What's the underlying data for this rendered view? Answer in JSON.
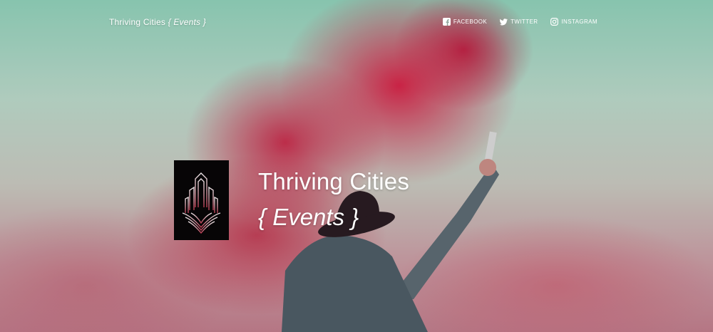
{
  "header": {
    "brand_name": "Thriving Cities",
    "brand_tag": "{ Events }"
  },
  "social": [
    {
      "label": "FACEBOOK",
      "icon": "facebook-icon"
    },
    {
      "label": "TWITTER",
      "icon": "twitter-icon"
    },
    {
      "label": "INSTAGRAM",
      "icon": "instagram-icon"
    }
  ],
  "hero": {
    "title": "Thriving Cities",
    "subtitle": "{ Events }",
    "logo_icon": "city-skyline-logo"
  },
  "colors": {
    "smoke_red": "#d61c42",
    "sky_mint": "#8fcfb8",
    "logo_bg": "#070506"
  }
}
